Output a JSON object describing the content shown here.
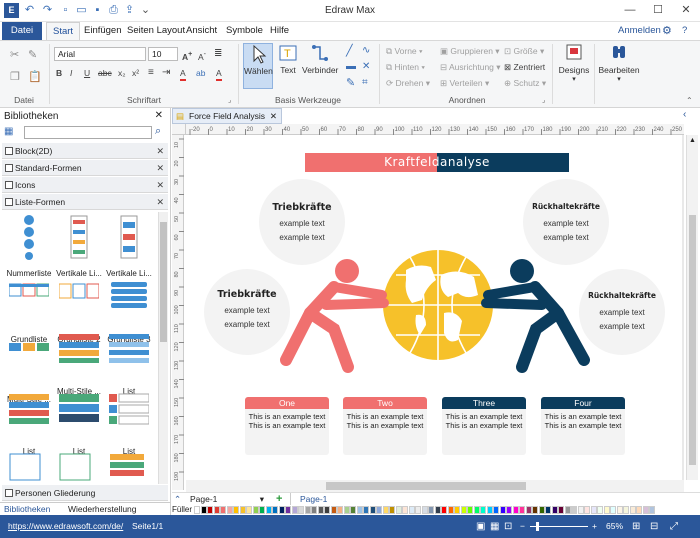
{
  "app": {
    "title": "Edraw Max"
  },
  "menu": {
    "file": "Datei",
    "tabs": [
      "Start",
      "Einfügen",
      "Seiten Layout",
      "Ansicht",
      "Symbole",
      "Hilfe"
    ],
    "signin": "Anmelden"
  },
  "ribbon": {
    "groups": {
      "file": "Datei",
      "font": "Schriftart",
      "tools": "Basis Werkzeuge",
      "arrange": "Anordnen"
    },
    "font_name": "Arial",
    "font_size": "10",
    "select": "Wählen",
    "text": "Text",
    "connector": "Verbinder",
    "front": "Vorne",
    "back": "Hinten",
    "rotate": "Drehen",
    "group": "Gruppieren",
    "align": "Ausrichtung",
    "distribute": "Verteilen",
    "size": "Größe",
    "center": "Zentriert",
    "protect": "Schutz",
    "designs": "Designs",
    "edit": "Bearbeiten"
  },
  "sidebar": {
    "title": "Bibliotheken",
    "categories": [
      "Block(2D)",
      "Standard-Formen",
      "Icons",
      "Liste-Formen"
    ],
    "shapes": [
      "Nummerliste",
      "Vertikale Li...",
      "Vertikale Li...",
      "Grundliste",
      "Grundliste 2",
      "Grundliste 3",
      "Multi-Stile ...",
      "Multi-Stile ...",
      "List",
      "List",
      "List",
      "List"
    ],
    "bottom_category": "Personen Gliederung",
    "bottom_tabs": [
      "Bibliotheken",
      "Wiederherstellung"
    ]
  },
  "document": {
    "tab": "Force Field Analysis",
    "title_left": "Kraftfeld",
    "title_right": "analyse",
    "circles": [
      {
        "title": "Triebkräfte",
        "lines": [
          "example text",
          "example text"
        ]
      },
      {
        "title": "Triebkräfte",
        "lines": [
          "example text",
          "example text"
        ]
      },
      {
        "title": "Rückhaltekräfte",
        "lines": [
          "example text",
          "example text"
        ]
      },
      {
        "title": "Rückhaltekräfte",
        "lines": [
          "example text",
          "example text"
        ]
      }
    ],
    "cards": [
      {
        "title": "One",
        "text": "This is an example text This is an example text"
      },
      {
        "title": "Two",
        "text": "This is an example text This is an example text"
      },
      {
        "title": "Three",
        "text": "This is an example text This is an example text"
      },
      {
        "title": "Four",
        "text": "This is an example text This is an example text"
      }
    ],
    "colors": {
      "salmon": "#f0706f",
      "navy": "#0b3c5d",
      "gold": "#f6c12a"
    }
  },
  "ruler": {
    "h": [
      "-20",
      "0",
      "10",
      "20",
      "30",
      "40",
      "50",
      "60",
      "70",
      "80",
      "90",
      "100",
      "110",
      "120",
      "130",
      "140",
      "150",
      "160",
      "170",
      "180",
      "190",
      "200",
      "210",
      "220",
      "230",
      "240",
      "250"
    ],
    "v": [
      "10",
      "20",
      "30",
      "40",
      "50",
      "60",
      "70",
      "80",
      "90",
      "100",
      "110",
      "120",
      "130",
      "140",
      "150",
      "160",
      "170",
      "180",
      "190"
    ]
  },
  "pagebar": {
    "page_select": "Page-1",
    "page_tab": "Page-1",
    "fill": "Füller"
  },
  "status": {
    "url": "https://www.edrawsoft.com/de/",
    "page": "Seite1/1",
    "zoom": "65%"
  }
}
